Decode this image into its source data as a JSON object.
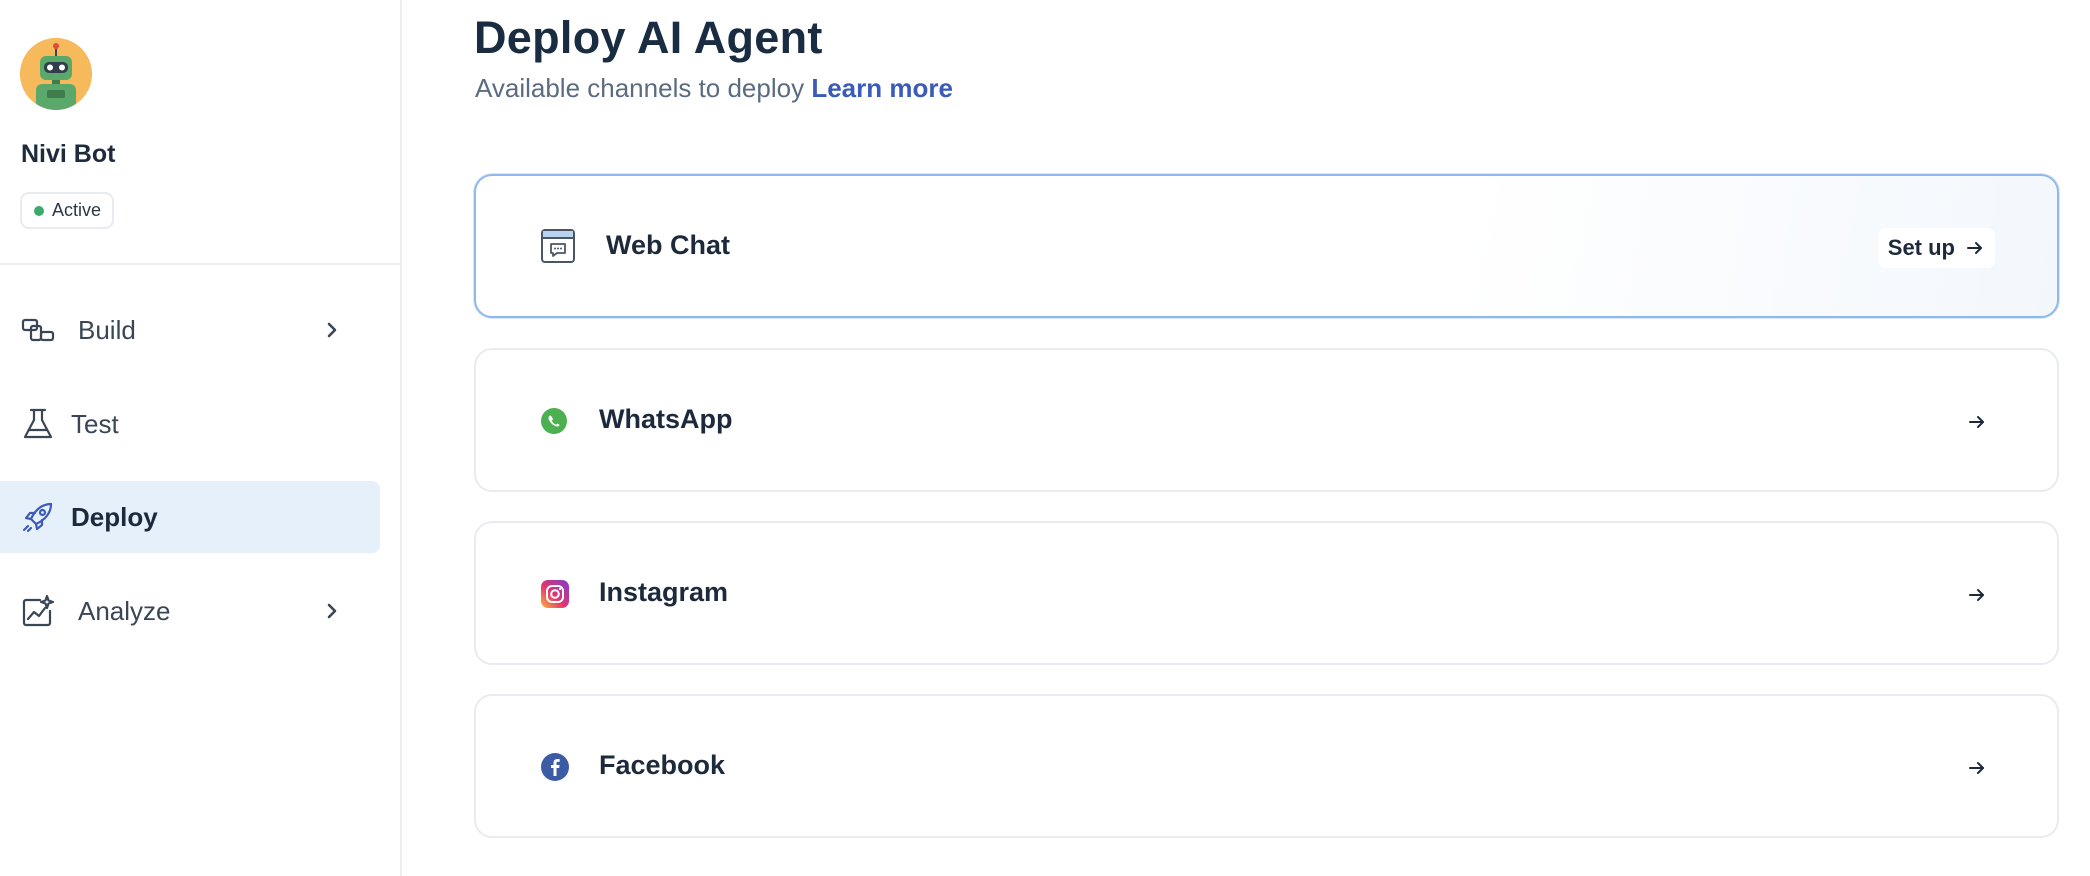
{
  "agent": {
    "name": "Nivi Bot",
    "status": "Active"
  },
  "sidebar": {
    "items": [
      {
        "label": "Build",
        "icon": "blocks-icon",
        "has_chevron": true
      },
      {
        "label": "Test",
        "icon": "flask-icon",
        "has_chevron": false
      },
      {
        "label": "Deploy",
        "icon": "rocket-icon",
        "has_chevron": false,
        "active": true
      },
      {
        "label": "Analyze",
        "icon": "chart-sparkle-icon",
        "has_chevron": true
      }
    ]
  },
  "main": {
    "title": "Deploy AI Agent",
    "subtitle": "Available channels to deploy",
    "learn_more": "Learn more",
    "channels": [
      {
        "label": "Web Chat",
        "icon": "web-chat-icon",
        "action_label": "Set up"
      },
      {
        "label": "WhatsApp",
        "icon": "whatsapp-icon"
      },
      {
        "label": "Instagram",
        "icon": "instagram-icon"
      },
      {
        "label": "Facebook",
        "icon": "facebook-icon"
      }
    ]
  },
  "colors": {
    "accent": "#3a5bb9",
    "active_nav_bg": "#e6f0fb",
    "status_dot": "#3caa6d",
    "selected_border": "#90b8ec",
    "whatsapp": "#4caf50",
    "facebook": "#3b5ba5"
  }
}
